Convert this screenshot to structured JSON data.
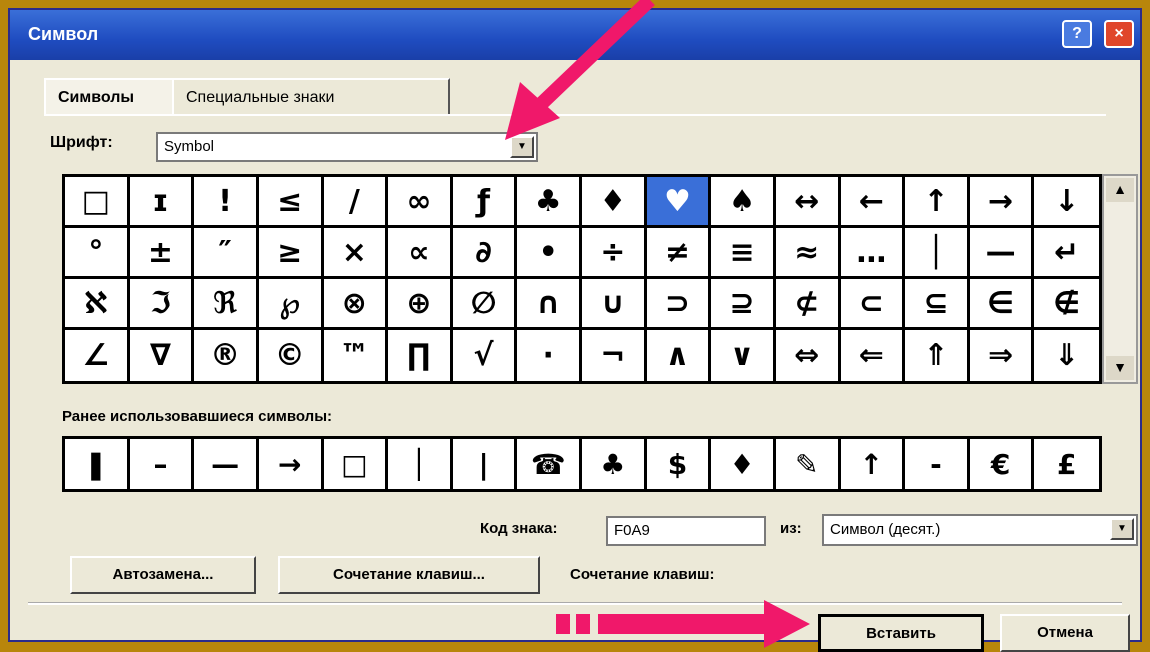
{
  "window": {
    "title": "Символ",
    "help_label": "?",
    "close_label": "×"
  },
  "tabs": [
    {
      "label": "Символы",
      "active": true
    },
    {
      "label": "Специальные знаки",
      "active": false
    }
  ],
  "font": {
    "label": "Шрифт:",
    "value": "Symbol"
  },
  "symbols": [
    "□",
    "ɪ",
    "!",
    "≤",
    "/",
    "∞",
    "ƒ",
    "♣",
    "♦",
    "♥",
    "♠",
    "↔",
    "←",
    "↑",
    "→",
    "↓",
    "°",
    "±",
    "″",
    "≥",
    "×",
    "∝",
    "∂",
    "•",
    "÷",
    "≠",
    "≡",
    "≈",
    "…",
    "│",
    "—",
    "↵",
    "ℵ",
    "ℑ",
    "ℜ",
    "℘",
    "⊗",
    "⊕",
    "∅",
    "∩",
    "∪",
    "⊃",
    "⊇",
    "⊄",
    "⊂",
    "⊆",
    "∈",
    "∉",
    "∠",
    "∇",
    "®",
    "©",
    "™",
    "∏",
    "√",
    "·",
    "¬",
    "∧",
    "∨",
    "⇔",
    "⇐",
    "⇑",
    "⇒",
    "⇓"
  ],
  "selected_index": 9,
  "recent": {
    "label": "Ранее использовавшиеся символы:",
    "items": [
      "❚",
      "–",
      "—",
      "→",
      "□",
      "│",
      "|",
      "☎",
      "♣",
      "$",
      "♦",
      "✎",
      "↑",
      "-",
      "€",
      "£"
    ]
  },
  "code": {
    "label": "Код знака:",
    "value": "F0A9"
  },
  "from": {
    "label": "из:",
    "value": "Символ (десят.)"
  },
  "buttons": {
    "autocorrect": "Автозамена...",
    "shortcut": "Сочетание клавиш...",
    "shortcut_text": "Сочетание клавиш:",
    "insert": "Вставить",
    "cancel": "Отмена"
  },
  "colors": {
    "arrow": "#f0186a",
    "selection": "#3a6fd8",
    "titlebar": "#1f4cc0"
  }
}
